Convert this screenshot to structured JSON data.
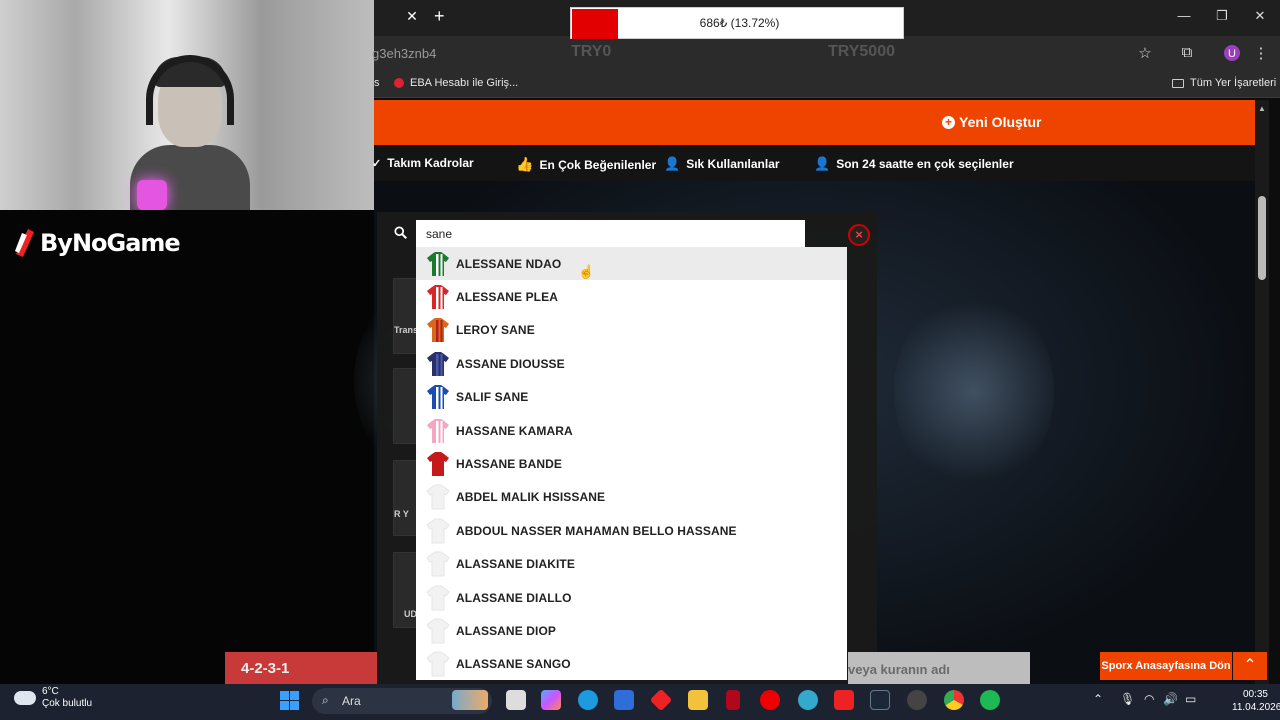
{
  "stream": {
    "brand": "ByNoGame",
    "donation": {
      "text": "686₺ (13.72%)",
      "percent": 13.72,
      "fill_color": "#e30000",
      "left_label": "TRY0",
      "right_label": "TRY5000"
    }
  },
  "browser": {
    "url_fragment": "g3eh3znb4",
    "bookmarks": {
      "left_cut": "s",
      "eba": "EBA Hesabı ile Giriş...",
      "all": "Tüm Yer İşaretleri"
    },
    "profile_initial": "U",
    "tab_close": "✕",
    "tab_add": "+"
  },
  "site": {
    "accent": "#ee4400",
    "new_button": "Yeni Oluştur",
    "nav": [
      "Takım Kadrolar",
      "En Çok Beğenilenler",
      "Sık Kullanılanlar",
      "Son 24 saatte en çok seçilenler"
    ],
    "side_labels": [
      "Trans",
      "R Y",
      "UD"
    ],
    "formation": "4-2-3-1",
    "name_placeholder": "veya kuranın adı",
    "sporx_button": "Sporx Anasayfasına Dön",
    "top_button": "⌃"
  },
  "search": {
    "value": "sane",
    "close": "×",
    "results": [
      {
        "name": "ALESSANE NDAO",
        "jersey": "green-stripes",
        "highlighted": true
      },
      {
        "name": "ALESSANE PLEA",
        "jersey": "red-white-stripes",
        "highlighted": false
      },
      {
        "name": "LEROY SANE",
        "jersey": "orange-red",
        "highlighted": false
      },
      {
        "name": "ASSANE DIOUSSE",
        "jersey": "navy",
        "highlighted": false
      },
      {
        "name": "SALIF SANE",
        "jersey": "blue",
        "highlighted": false
      },
      {
        "name": "HASSANE KAMARA",
        "jersey": "pink",
        "highlighted": false
      },
      {
        "name": "HASSANE BANDE",
        "jersey": "red",
        "highlighted": false
      },
      {
        "name": "ABDEL MALIK HSISSANE",
        "jersey": "blank",
        "highlighted": false
      },
      {
        "name": "ABDOUL NASSER MAHAMAN BELLO HASSANE",
        "jersey": "blank",
        "highlighted": false
      },
      {
        "name": "ALASSANE DIAKITE",
        "jersey": "blank",
        "highlighted": false
      },
      {
        "name": "ALASSANE DIALLO",
        "jersey": "blank",
        "highlighted": false
      },
      {
        "name": "ALASSANE DIOP",
        "jersey": "blank",
        "highlighted": false
      },
      {
        "name": "ALASSANE SANGO",
        "jersey": "blank",
        "highlighted": false
      }
    ]
  },
  "taskbar": {
    "temp": "6°C",
    "weather": "Çok bulutlu",
    "search": "Ara",
    "time": "00:35",
    "date": "11.04.2026"
  }
}
